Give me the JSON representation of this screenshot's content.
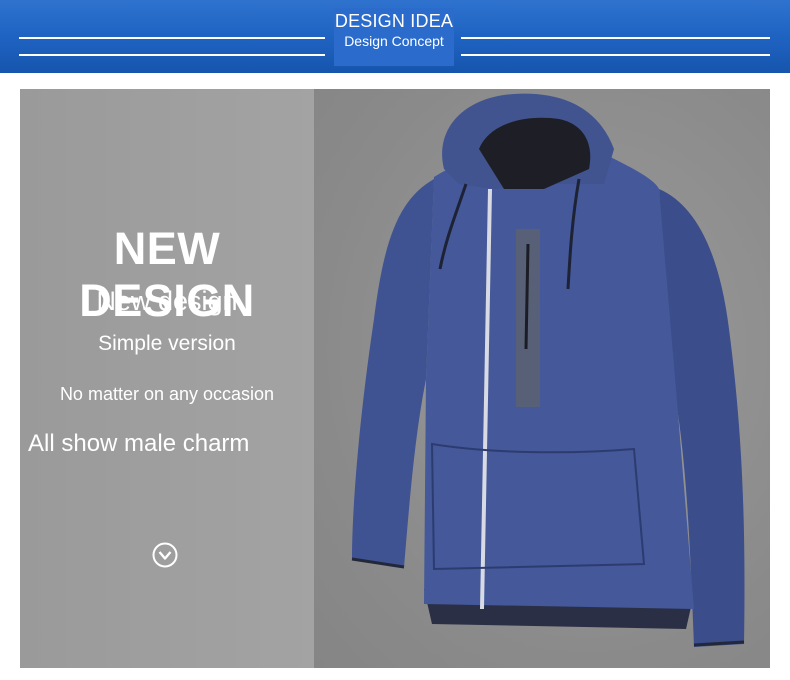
{
  "header": {
    "title": "DESIGN IDEA",
    "subtitle": "Design Concept",
    "background_color": "#1f63c2"
  },
  "feature": {
    "headline": "NEW DESIGN",
    "line1": "New design",
    "line2": "Simple version",
    "line3": "No matter on any occasion",
    "line4": "All show male charm",
    "icon": "chevron-down-circle-icon"
  },
  "product": {
    "image": "blue zip-up hoodie jacket",
    "color": "#3d4f8c"
  }
}
